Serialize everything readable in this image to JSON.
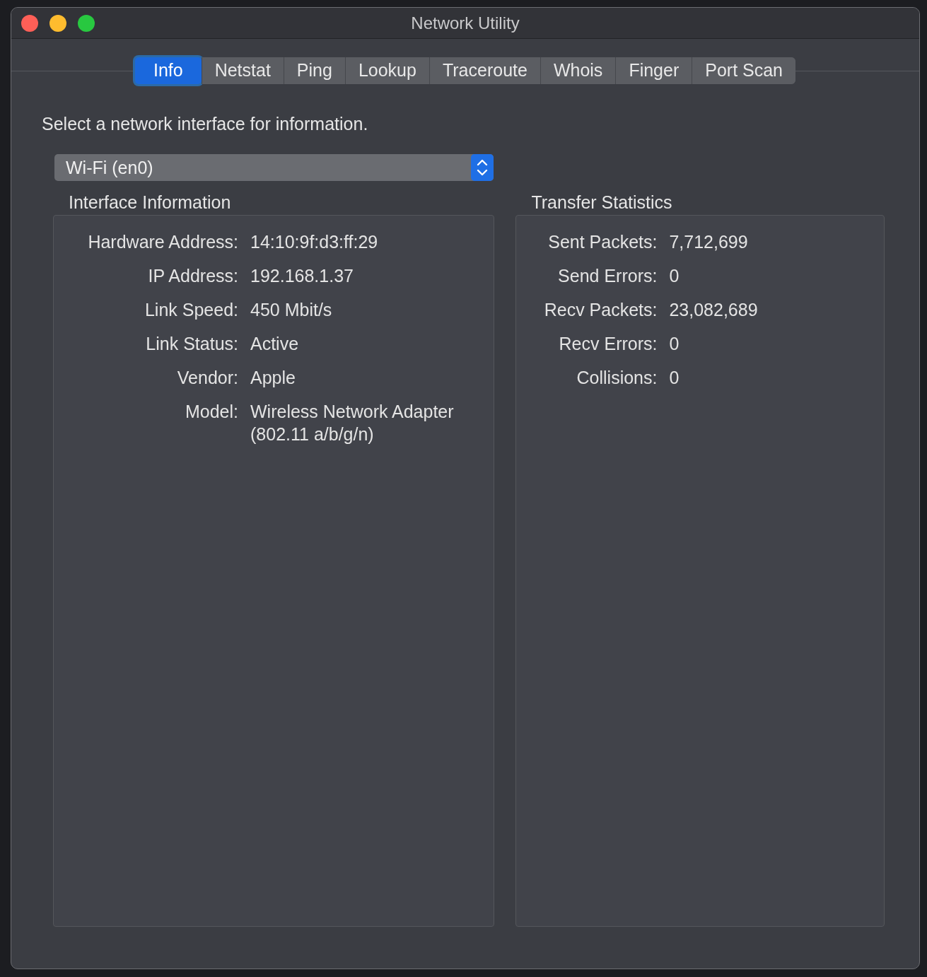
{
  "window": {
    "title": "Network Utility"
  },
  "tabs": [
    {
      "label": "Info",
      "selected": true
    },
    {
      "label": "Netstat",
      "selected": false
    },
    {
      "label": "Ping",
      "selected": false
    },
    {
      "label": "Lookup",
      "selected": false
    },
    {
      "label": "Traceroute",
      "selected": false
    },
    {
      "label": "Whois",
      "selected": false
    },
    {
      "label": "Finger",
      "selected": false
    },
    {
      "label": "Port Scan",
      "selected": false
    }
  ],
  "prompt": "Select a network interface for information.",
  "interface_select": {
    "value": "Wi-Fi (en0)"
  },
  "interface_information": {
    "title": "Interface Information",
    "fields": [
      {
        "label": "Hardware Address:",
        "value": "14:10:9f:d3:ff:29"
      },
      {
        "label": "IP Address:",
        "value": "192.168.1.37"
      },
      {
        "label": "Link Speed:",
        "value": "450 Mbit/s"
      },
      {
        "label": "Link Status:",
        "value": "Active"
      },
      {
        "label": "Vendor:",
        "value": "Apple"
      },
      {
        "label": "Model:",
        "value": "Wireless Network Adapter (802.11 a/b/g/n)"
      }
    ]
  },
  "transfer_statistics": {
    "title": "Transfer Statistics",
    "fields": [
      {
        "label": "Sent Packets:",
        "value": "7,712,699"
      },
      {
        "label": "Send Errors:",
        "value": "0"
      },
      {
        "label": "Recv Packets:",
        "value": "23,082,689"
      },
      {
        "label": "Recv Errors:",
        "value": "0"
      },
      {
        "label": "Collisions:",
        "value": "0"
      }
    ]
  }
}
